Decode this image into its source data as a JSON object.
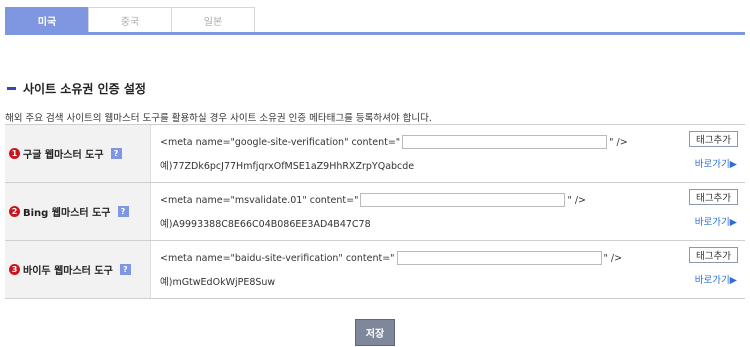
{
  "tabs": [
    "미국",
    "중국",
    "일본"
  ],
  "section": {
    "title": "사이트 소유권 인증 설정",
    "description": "해외 주요 검색 사이트의 웹마스터 도구를 활용하실 경우 사이트 소유권 인증 메타태그를 등록하셔야 합니다."
  },
  "rows": [
    {
      "number": "1",
      "label": "구글 웹마스터 도구",
      "help": "?",
      "meta_prefix": "<meta name=\"google-site-verification\" content=\"",
      "meta_suffix": "\" />",
      "input_value": "",
      "example": "예)77ZDk6pcJ77HmfjqrxOfMSE1aZ9HhRXZrpYQabcde",
      "tag_button": "태그추가",
      "goto_link": "바로가기▶"
    },
    {
      "number": "2",
      "label": "Bing 웹마스터 도구",
      "help": "?",
      "meta_prefix": "<meta name=\"msvalidate.01\" content=\"",
      "meta_suffix": "\" />",
      "input_value": "",
      "example": "예)A9993388C8E66C04B086EE3AD4B47C78",
      "tag_button": "태그추가",
      "goto_link": "바로가기▶"
    },
    {
      "number": "3",
      "label": "바이두 웹마스터 도구",
      "help": "?",
      "meta_prefix": "<meta name=\"baidu-site-verification\" content=\"",
      "meta_suffix": "\" />",
      "input_value": "",
      "example": "예)mGtwEdOkWjPE8Suw",
      "tag_button": "태그추가",
      "goto_link": "바로가기▶"
    }
  ],
  "save_label": "저장",
  "colors": {
    "accent": "#7e97e0",
    "title_bar": "#2d4fa8",
    "number_badge": "#c8161d",
    "link": "#2b6fd6"
  }
}
